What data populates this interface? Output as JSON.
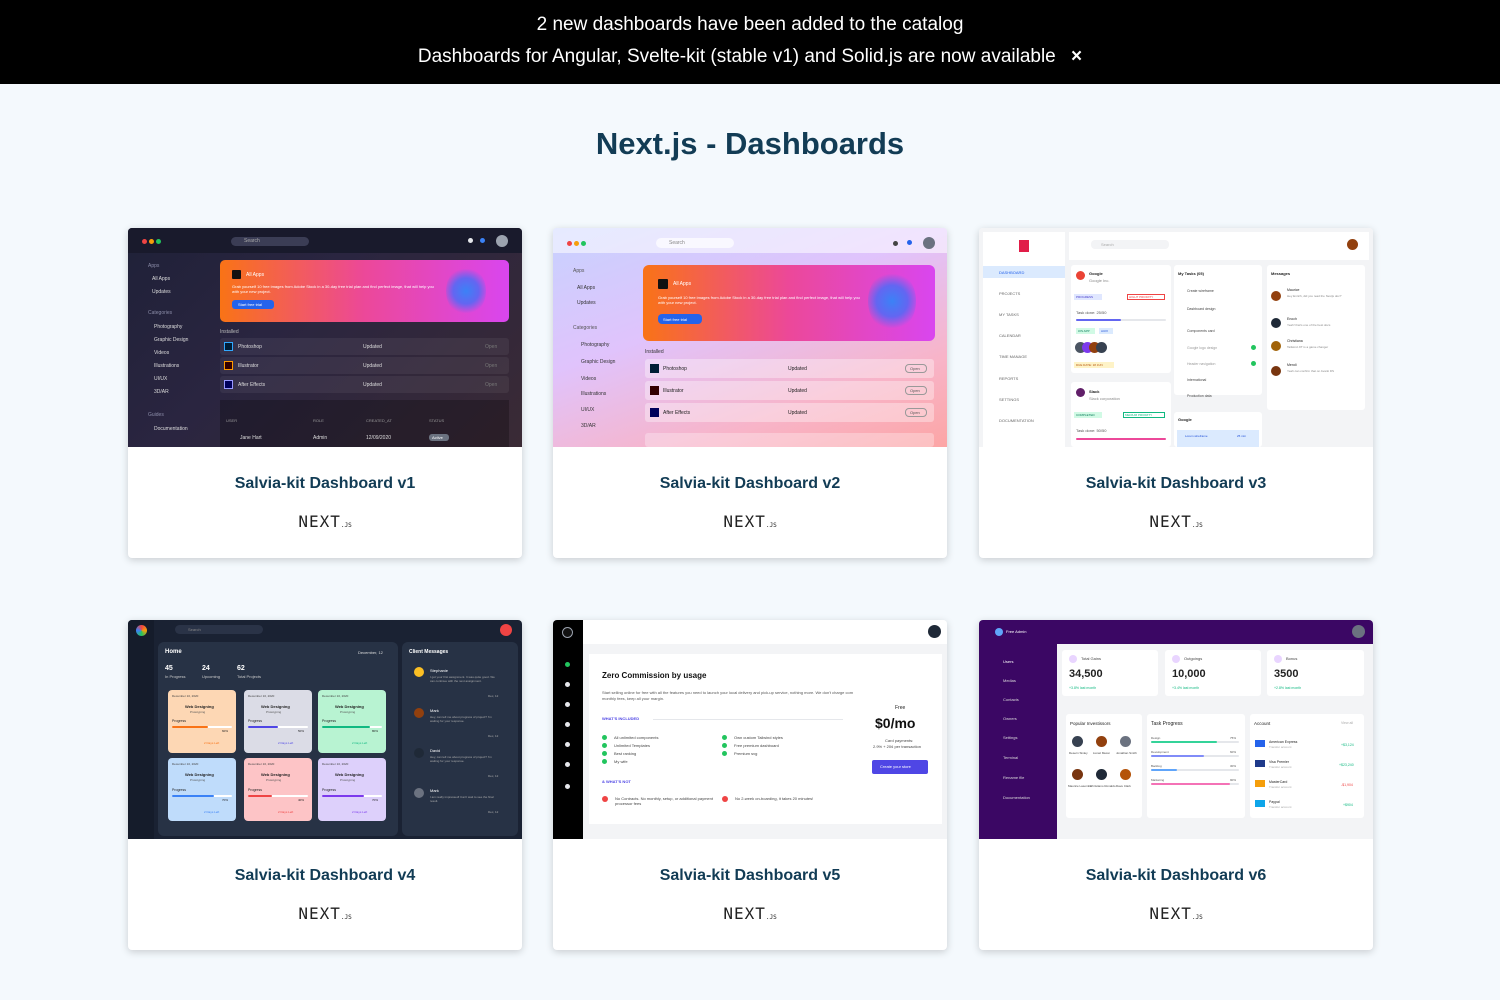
{
  "banner": {
    "line1": "2 new dashboards have been added to the catalog",
    "line2": "Dashboards for Angular, Svelte-kit (stable v1) and Solid.js are now available",
    "close_icon": "×"
  },
  "page_title": "Next.js - Dashboards",
  "framework_logo": "NEXT",
  "framework_logo_suffix": ".JS",
  "cards": [
    {
      "title": "Salvia-kit Dashboard v1",
      "preview": {
        "search": "Search",
        "nav_apps": "Apps",
        "nav": [
          "All Apps",
          "Updates"
        ],
        "categories_label": "Categories",
        "categories": [
          "Photography",
          "Graphic Design",
          "Videos",
          "Illustrations",
          "UI/UX",
          "3D/AR"
        ],
        "guides_label": "Guides",
        "guides": [
          "Documentation"
        ],
        "hero_title": "All Apps",
        "hero_text": "Grab yourself 10 free images from Adobe Stock in a 30-day free trial plan and find perfect image, that will help you with your new project.",
        "hero_button": "Start free trial",
        "installed_label": "Installed",
        "apps": [
          {
            "name": "Photoshop",
            "status": "Updated",
            "action": "Open"
          },
          {
            "name": "Illustrator",
            "status": "Updated",
            "action": "Open"
          },
          {
            "name": "After Effects",
            "status": "Updated",
            "action": "Open"
          }
        ],
        "table_headers": [
          "USER",
          "ROLE",
          "CREATED_AT",
          "STATUS"
        ],
        "table_row": [
          "Jane Hart",
          "Admin",
          "12/09/2020",
          "Active"
        ]
      }
    },
    {
      "title": "Salvia-kit Dashboard v2",
      "preview": {
        "search": "Search",
        "nav_apps": "Apps",
        "nav": [
          "All Apps",
          "Updates"
        ],
        "categories_label": "Categories",
        "categories": [
          "Photography",
          "Graphic Design",
          "Videos",
          "Illustrations",
          "UI/UX",
          "3D/AR"
        ],
        "hero_title": "All Apps",
        "hero_text": "Grab yourself 10 free images from Adobe Stock in a 30-day free trial plan and find perfect image, that will help you with your new project.",
        "hero_button": "Start free trial",
        "installed_label": "Installed",
        "apps": [
          {
            "name": "Photoshop",
            "status": "Updated",
            "action": "Open"
          },
          {
            "name": "Illustrator",
            "status": "Updated",
            "action": "Open"
          },
          {
            "name": "After Effects",
            "status": "Updated",
            "action": "Open"
          }
        ]
      }
    },
    {
      "title": "Salvia-kit Dashboard v3",
      "preview": {
        "search": "Search",
        "nav": [
          "DASHBOARD",
          "PROJECTS",
          "MY TASKS",
          "CALENDAR",
          "TIME MANAGE",
          "REPORTS",
          "SETTINGS",
          "DOCUMENTATION"
        ],
        "project1": {
          "name": "Google",
          "sub": "Google Inc.",
          "tag": "PROGRESS",
          "priority": "HIGHT PRIORITY",
          "tasks": "Task done: 25/50",
          "chips": [
            "iOS APP",
            "AUIX"
          ],
          "due": "DUE DATE: 18 JUN"
        },
        "project2": {
          "name": "Slack",
          "sub": "Slack corporation",
          "tag": "COMPLETED",
          "priority": "MEDIUM PRIORITY",
          "tasks": "Task done: 50/50"
        },
        "tasks_title": "My Tasks (05)",
        "tasks": [
          "Create wireframe",
          "Dashboard design",
          "Components card",
          "Google logo design",
          "Header navigation",
          "International",
          "Production data"
        ],
        "messages_title": "Messages",
        "messages": [
          {
            "name": "Maurice",
            "text": "Hey Enrich, did you read the Nextjs doc?"
          },
          {
            "name": "Enoch",
            "text": "Yeah! that's one of the best docs"
          },
          {
            "name": "Christiana",
            "text": "Tailwind JIT is a game changer"
          },
          {
            "name": "Mendi",
            "text": "Yeah can confirm that on Avanti DS"
          }
        ],
        "calendar_title": "Google",
        "calendar_item": "Lorem wireframe",
        "calendar_time": "25 min"
      }
    },
    {
      "title": "Salvia-kit Dashboard v4",
      "preview": {
        "search": "Search",
        "home": "Home",
        "date": "December, 12",
        "stats": [
          {
            "value": "45",
            "label": "In Progress"
          },
          {
            "value": "24",
            "label": "Upcoming"
          },
          {
            "value": "62",
            "label": "Total Projects"
          }
        ],
        "projects": [
          {
            "date": "December 10, 2020",
            "title": "Web Designing",
            "sub": "Prototyping",
            "pct": "60%",
            "left": "2 Days Left",
            "color": "#fdd7b4"
          },
          {
            "date": "December 10, 2020",
            "title": "Web Designing",
            "sub": "Prototyping",
            "pct": "50%",
            "left": "2 Days Left",
            "color": "#dbdce6"
          },
          {
            "date": "December 10, 2020",
            "title": "Web Designing",
            "sub": "Prototyping",
            "pct": "80%",
            "left": "2 Days Left",
            "color": "#b8f3d2"
          },
          {
            "date": "December 10, 2020",
            "title": "Web Designing",
            "sub": "Prototyping",
            "pct": "70%",
            "left": "2 Days Left",
            "color": "#bfdcfb"
          },
          {
            "date": "December 10, 2020",
            "title": "Web Designing",
            "sub": "Prototyping",
            "pct": "40%",
            "left": "2 Days Left",
            "color": "#fdc4c6"
          },
          {
            "date": "December 10, 2020",
            "title": "Web Designing",
            "sub": "Prototyping",
            "pct": "70%",
            "left": "2 Days Left",
            "color": "#ddd0fb"
          }
        ],
        "progress_label": "Progress",
        "messages_title": "Client Messages",
        "messages": [
          {
            "name": "Stephanie",
            "text": "I got your first assignment. It was quite good. We can continue with the next assignment.",
            "date": "Dec, 12"
          },
          {
            "name": "Mark",
            "text": "Hey, can tell me about progress of project? I'm waiting for your response.",
            "date": "Dec, 12"
          },
          {
            "name": "David",
            "text": "Hey, can tell me about progress of project? I'm waiting for your response.",
            "date": "Dec, 12"
          },
          {
            "name": "Mark",
            "text": "I am really impressed! Can't wait to see the final result.",
            "date": "Dec, 12"
          }
        ]
      }
    },
    {
      "title": "Salvia-kit Dashboard v5",
      "preview": {
        "heading": "Zero Commission by usage",
        "intro": "Start selling online for free with all the features you need to launch your local delivery and pick-up service, nothing more. We don't charge commission or monthly fees, keep all your margin.",
        "included_label": "WHAT'S INCLUDED",
        "included_left": [
          "All unlimited components",
          "Unlimited Templates",
          "Best ranking",
          "My wife"
        ],
        "included_right": [
          "Own custom Tailwind styles",
          "Free premium dashboard",
          "Premium svg"
        ],
        "not_label": "& WHAT'S NOT",
        "not_items": [
          "No Contracts. No monthly, setup, or additional payment processor fees",
          "No 2-week on-boarding, it takes 20 minutes!"
        ],
        "plan_label": "Free",
        "price": "$0/mo",
        "fee_line1": "Card payments:",
        "fee_line2": "2.9% + 20¢ per transaction",
        "cta": "Create your store"
      }
    },
    {
      "title": "Salvia-kit Dashboard v6",
      "preview": {
        "brand": "Free Admin",
        "nav": [
          "Users",
          "Medias",
          "Contacts",
          "Owners",
          "Settings",
          "Terminal",
          "Rename file",
          "Documentation"
        ],
        "stats": [
          {
            "label": "Total Gains",
            "value": "34,500",
            "change": "+3.8% last month"
          },
          {
            "label": "Outgoings",
            "value": "10,000",
            "change": "+3.4% last month"
          },
          {
            "label": "Bonus",
            "value": "3500",
            "change": "+2.8% last month"
          }
        ],
        "investors_title": "Popular Investissors",
        "investors": [
          "Desern Sinley",
          "Lionel Messi",
          "Jonathan Smith",
          "Maurice Lasombe",
          "Christiano Ronaldo",
          "Dave Clark"
        ],
        "progress_title": "Task Progress",
        "progress": [
          {
            "label": "Design",
            "value": "75%",
            "color": "#34d399"
          },
          {
            "label": "Development",
            "value": "60%",
            "color": "#818cf8"
          },
          {
            "label": "Backlog",
            "value": "30%",
            "color": "#60a5fa"
          },
          {
            "label": "Marketing",
            "value": "90%",
            "color": "#f472b6"
          }
        ],
        "account_title": "Account",
        "account_link": "View all",
        "accounts": [
          {
            "name": "American Express",
            "sub": "Transfer account",
            "amount": "+$3,124",
            "color": "#10b981"
          },
          {
            "name": "Visa Premier",
            "sub": "Transfer account",
            "amount": "+$23,240",
            "color": "#10b981"
          },
          {
            "name": "MasterCard",
            "sub": "Transfer account",
            "amount": "-$1,904",
            "color": "#ef4444"
          },
          {
            "name": "Paypal",
            "sub": "Transfer account",
            "amount": "+$904",
            "color": "#10b981"
          }
        ]
      }
    }
  ]
}
